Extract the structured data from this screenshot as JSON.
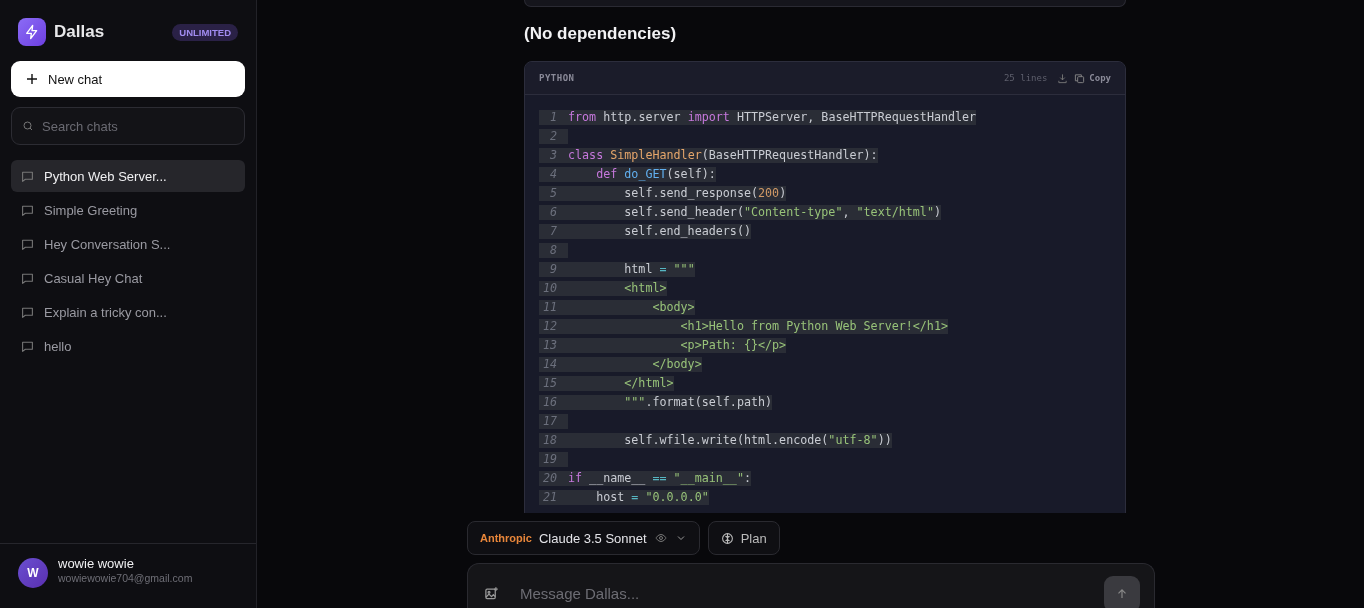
{
  "sidebar": {
    "brand": "Dallas",
    "plan_badge": "UNLIMITED",
    "new_chat": "New chat",
    "search": {
      "placeholder": "Search chats"
    },
    "chats": [
      {
        "title": "Python Web Server...",
        "selected": true
      },
      {
        "title": "Simple Greeting",
        "selected": false
      },
      {
        "title": "Hey Conversation S...",
        "selected": false
      },
      {
        "title": "Casual Hey Chat",
        "selected": false
      },
      {
        "title": "Explain a tricky con...",
        "selected": false
      },
      {
        "title": "hello",
        "selected": false
      }
    ],
    "user": {
      "initial": "W",
      "name": "wowie wowie",
      "email": "wowiewowie704@gmail.com"
    }
  },
  "message": {
    "heading": "(No dependencies)",
    "code_block": {
      "language": "PYTHON",
      "line_count": "25 lines",
      "copy": "Copy",
      "lines": [
        {
          "number": "1",
          "tokens": [
            {
              "kind": "kw",
              "text": "from"
            },
            {
              "kind": "plain",
              "text": " http.server "
            },
            {
              "kind": "kw",
              "text": "import"
            },
            {
              "kind": "plain",
              "text": " HTTPServer, BaseHTTPRequestHandler"
            }
          ]
        },
        {
          "number": "2"
        },
        {
          "number": "3",
          "tokens": [
            {
              "kind": "kw",
              "text": "class"
            },
            {
              "kind": "cls",
              "text": " SimpleHandler"
            },
            {
              "kind": "plain",
              "text": "(BaseHTTPRequestHandler):"
            }
          ]
        },
        {
          "number": "4",
          "tokens": [
            {
              "kind": "kw",
              "text": "    def"
            },
            {
              "kind": "fn",
              "text": " do_GET"
            },
            {
              "kind": "plain",
              "text": "(self):"
            }
          ]
        },
        {
          "number": "5",
          "tokens": [
            {
              "kind": "plain",
              "text": "        self.send_response("
            },
            {
              "kind": "num",
              "text": "200"
            },
            {
              "kind": "plain",
              "text": ")"
            }
          ]
        },
        {
          "number": "6",
          "tokens": [
            {
              "kind": "plain",
              "text": "        self.send_header("
            },
            {
              "kind": "str",
              "text": "\"Content-type\""
            },
            {
              "kind": "plain",
              "text": ", "
            },
            {
              "kind": "str",
              "text": "\"text/html\""
            },
            {
              "kind": "plain",
              "text": ")"
            }
          ]
        },
        {
          "number": "7",
          "tokens": [
            {
              "kind": "plain",
              "text": "        self.end_headers()"
            }
          ]
        },
        {
          "number": "8"
        },
        {
          "number": "9",
          "tokens": [
            {
              "kind": "plain",
              "text": "        html "
            },
            {
              "kind": "op",
              "text": "="
            },
            {
              "kind": "str",
              "text": " \"\"\""
            }
          ]
        },
        {
          "number": "10",
          "tokens": [
            {
              "kind": "str",
              "text": "        <html>"
            }
          ]
        },
        {
          "number": "11",
          "tokens": [
            {
              "kind": "str",
              "text": "            <body>"
            }
          ]
        },
        {
          "number": "12",
          "tokens": [
            {
              "kind": "str",
              "text": "                <h1>Hello from Python Web Server!</h1>"
            }
          ]
        },
        {
          "number": "13",
          "tokens": [
            {
              "kind": "str",
              "text": "                <p>Path: {}</p>"
            }
          ]
        },
        {
          "number": "14",
          "tokens": [
            {
              "kind": "str",
              "text": "            </body>"
            }
          ]
        },
        {
          "number": "15",
          "tokens": [
            {
              "kind": "str",
              "text": "        </html>"
            }
          ]
        },
        {
          "number": "16",
          "tokens": [
            {
              "kind": "str",
              "text": "        \"\"\""
            },
            {
              "kind": "plain",
              "text": ".format(self.path)"
            }
          ]
        },
        {
          "number": "17"
        },
        {
          "number": "18",
          "tokens": [
            {
              "kind": "plain",
              "text": "        self.wfile.write(html.encode("
            },
            {
              "kind": "str",
              "text": "\"utf-8\""
            },
            {
              "kind": "plain",
              "text": "))"
            }
          ]
        },
        {
          "number": "19"
        },
        {
          "number": "20",
          "tokens": [
            {
              "kind": "kw",
              "text": "if"
            },
            {
              "kind": "plain",
              "text": " __name__ "
            },
            {
              "kind": "op",
              "text": "=="
            },
            {
              "kind": "str",
              "text": " \"__main__\""
            },
            {
              "kind": "plain",
              "text": ":"
            }
          ]
        },
        {
          "number": "21",
          "tokens": [
            {
              "kind": "plain",
              "text": "    host "
            },
            {
              "kind": "op",
              "text": "="
            },
            {
              "kind": "str",
              "text": " \"0.0.0.0\""
            }
          ]
        }
      ]
    }
  },
  "composer": {
    "provider": "Anthropic",
    "model": "Claude 3.5 Sonnet",
    "plan": "Plan",
    "input": {
      "placeholder": "Message Dallas..."
    }
  }
}
